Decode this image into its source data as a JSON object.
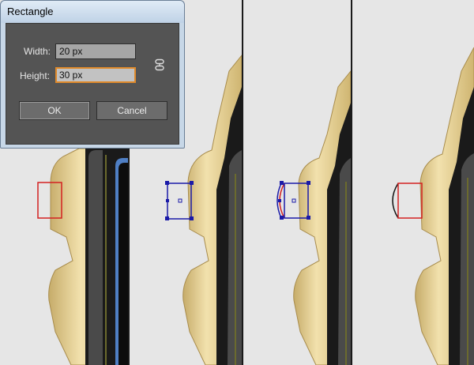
{
  "dialog": {
    "title": "Rectangle",
    "width_label": "Width:",
    "width_value": "20 px",
    "height_label": "Height:",
    "height_value": "30 px",
    "link_icon": "constrain-proportions-icon",
    "ok_label": "OK",
    "cancel_label": "Cancel"
  },
  "colors": {
    "accent_focus": "#e08a2a",
    "selection": "#1a1aa8",
    "guide_rect": "#d42020",
    "gold": "#e3c985",
    "screen_blue": "#4f7fc4"
  }
}
